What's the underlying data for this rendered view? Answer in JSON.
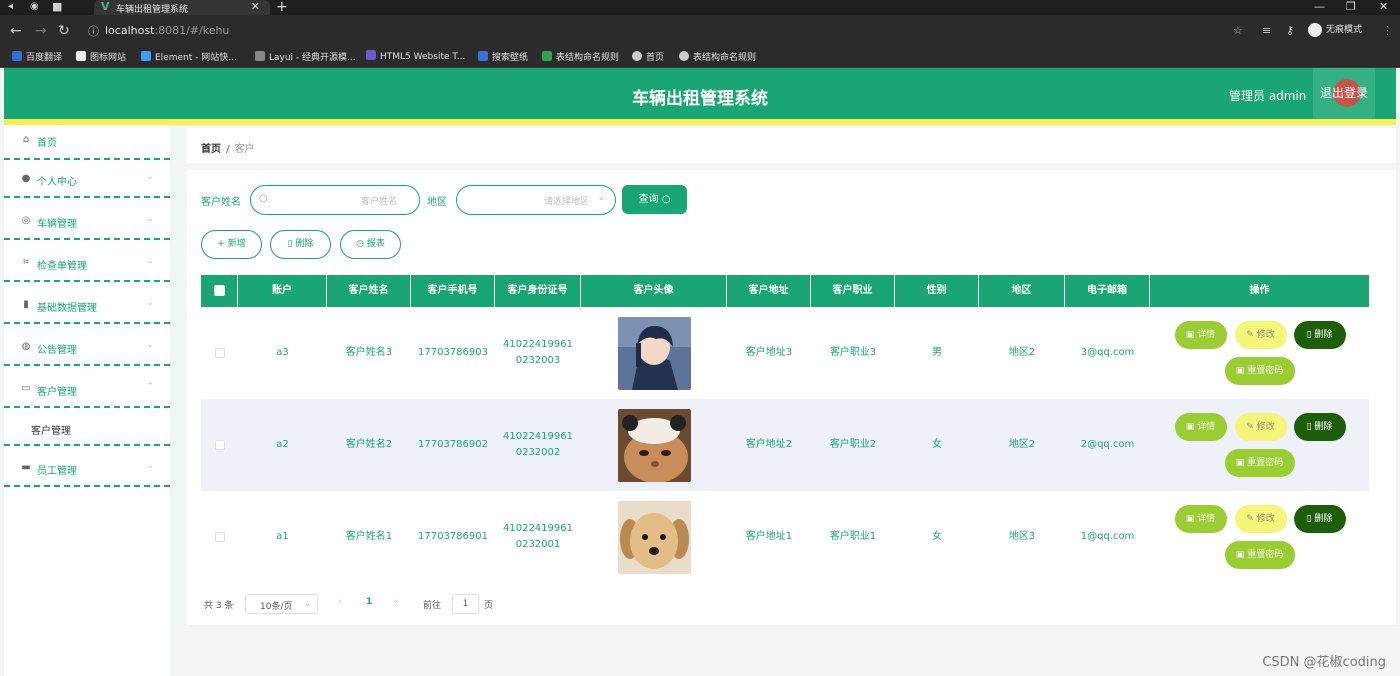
{
  "browser": {
    "tab_title": "车辆出租管理系统",
    "url_host": "localhost",
    "url_rest": ":8081/#/kehu",
    "incognito_label": "无痕模式",
    "bookmarks": [
      "百度翻译",
      "图标网站",
      "Element - 网站快...",
      "Layui - 经典开源模...",
      "HTML5 Website T...",
      "搜索壁纸",
      "表结构命名规则",
      "首页",
      "表结构命名规则"
    ]
  },
  "header": {
    "title": "车辆出租管理系统",
    "admin_label": "管理员 admin",
    "logout_label": "退出登录"
  },
  "sidebar": {
    "items": [
      {
        "label": "首页"
      },
      {
        "label": "个人中心"
      },
      {
        "label": "车辆管理"
      },
      {
        "label": "检查单管理"
      },
      {
        "label": "基础数据管理"
      },
      {
        "label": "公告管理"
      },
      {
        "label": "客户管理"
      },
      {
        "label": "员工管理"
      }
    ],
    "sub_label": "客户管理"
  },
  "breadcrumb": {
    "home": "首页",
    "sep": "/",
    "current": "客户"
  },
  "search": {
    "name_label": "客户姓名",
    "name_placeholder": "客户姓名",
    "region_label": "地区",
    "region_placeholder": "请选择地区",
    "query_label": "查询"
  },
  "actions": {
    "add": "新增",
    "delete": "删除",
    "report": "报表"
  },
  "table": {
    "headers": [
      "账户",
      "客户姓名",
      "客户手机号",
      "客户身份证号",
      "客户头像",
      "客户地址",
      "客户职业",
      "性别",
      "地区",
      "电子邮箱",
      "操作"
    ],
    "rows": [
      {
        "account": "a3",
        "name": "客户姓名3",
        "phone": "17703786903",
        "id1": "41022419961",
        "id2": "0232003",
        "address": "客户地址3",
        "job": "客户职业3",
        "gender": "男",
        "region": "地区2",
        "email": "3@qq.com"
      },
      {
        "account": "a2",
        "name": "客户姓名2",
        "phone": "17703786902",
        "id1": "41022419961",
        "id2": "0232002",
        "address": "客户地址2",
        "job": "客户职业2",
        "gender": "女",
        "region": "地区2",
        "email": "2@qq.com"
      },
      {
        "account": "a1",
        "name": "客户姓名1",
        "phone": "17703786901",
        "id1": "41022419961",
        "id2": "0232001",
        "address": "客户地址1",
        "job": "客户职业1",
        "gender": "女",
        "region": "地区3",
        "email": "1@qq.com"
      }
    ],
    "ops": {
      "detail": "详情",
      "edit": "修改",
      "delete": "删除",
      "reset": "重置密码"
    }
  },
  "pager": {
    "total": "共 3 条",
    "size": "10条/页",
    "page": "1",
    "goto": "前往",
    "goto_value": "1",
    "page_unit": "页"
  },
  "watermark": "CSDN @花椒coding",
  "colors": {
    "primary": "#1aa574",
    "stripe": "#f2f255",
    "detail": "#9acd32",
    "edit": "#f5f57a",
    "delete": "#1e5e0b"
  }
}
